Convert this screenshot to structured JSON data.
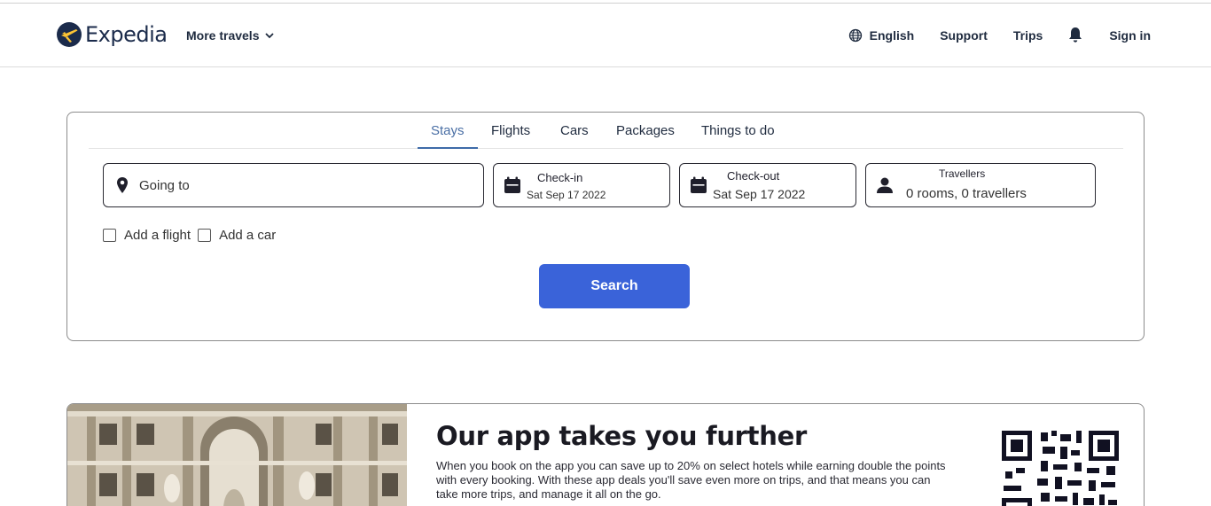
{
  "header": {
    "brand": "Expedia",
    "more_travels": "More travels",
    "language": "English",
    "support": "Support",
    "trips": "Trips",
    "sign_in": "Sign in"
  },
  "search": {
    "tabs": [
      {
        "label": "Stays",
        "active": true
      },
      {
        "label": "Flights",
        "active": false
      },
      {
        "label": "Cars",
        "active": false
      },
      {
        "label": "Packages",
        "active": false
      },
      {
        "label": "Things to do",
        "active": false
      }
    ],
    "going_to_placeholder": "Going to",
    "checkin_label": "Check-in",
    "checkin_value": "Sat Sep 17 2022",
    "checkout_label": "Check-out",
    "checkout_value": "Sat Sep 17 2022",
    "travellers_label": "Travellers",
    "travellers_value": "0 rooms, 0 travellers",
    "add_flight": "Add a flight",
    "add_car": "Add a car",
    "search_button": "Search"
  },
  "promo": {
    "title": "Our app takes you further",
    "body": "When you book on the app you can save up to 20% on select hotels while earning double the points with every booking. With these app deals you'll save even more on trips, and that means you can take more trips, and manage it all on the go."
  },
  "colors": {
    "brand_navy": "#1b2b4b",
    "brand_yellow": "#fdc434",
    "accent_blue": "#3a63d9",
    "active_tab": "#3e6ba8"
  },
  "icons": [
    "expedia-logo-icon",
    "chevron-down-icon",
    "globe-icon",
    "bell-icon",
    "map-pin-icon",
    "calendar-icon",
    "person-icon",
    "checkbox-icon",
    "qr-code-icon"
  ]
}
